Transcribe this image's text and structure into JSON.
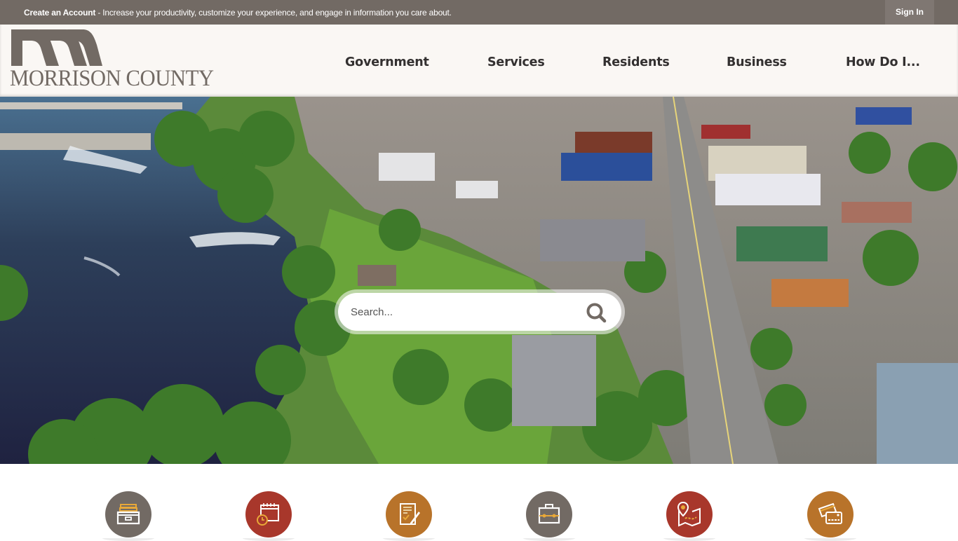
{
  "topbar": {
    "promo_bold": "Create an Account",
    "promo_text": " - Increase your productivity, customize your experience, and engage in information you care about.",
    "signin_label": "Sign In"
  },
  "header": {
    "logo_text": "MORRISON COUNTY",
    "nav": [
      {
        "label": "Government"
      },
      {
        "label": "Services"
      },
      {
        "label": "Residents"
      },
      {
        "label": "Business"
      },
      {
        "label": "How Do I..."
      }
    ]
  },
  "hero": {
    "search": {
      "placeholder": "Search...",
      "value": "",
      "button_icon": "search-icon"
    }
  },
  "quick_links": [
    {
      "icon": "file-cabinet-icon",
      "color": "#726a64"
    },
    {
      "icon": "calendar-clock-icon",
      "color": "#a8372b"
    },
    {
      "icon": "document-sign-icon",
      "color": "#b8732a"
    },
    {
      "icon": "briefcase-icon",
      "color": "#726a64"
    },
    {
      "icon": "map-pin-icon",
      "color": "#a8372b"
    },
    {
      "icon": "payment-cards-icon",
      "color": "#b8732a"
    }
  ],
  "colors": {
    "topbar_bg": "#726a64",
    "header_bg": "#faf7f4",
    "accent_gold": "#e8a838",
    "brand_gray": "#726a64",
    "brand_red": "#a8372b",
    "brand_orange": "#b8732a"
  }
}
